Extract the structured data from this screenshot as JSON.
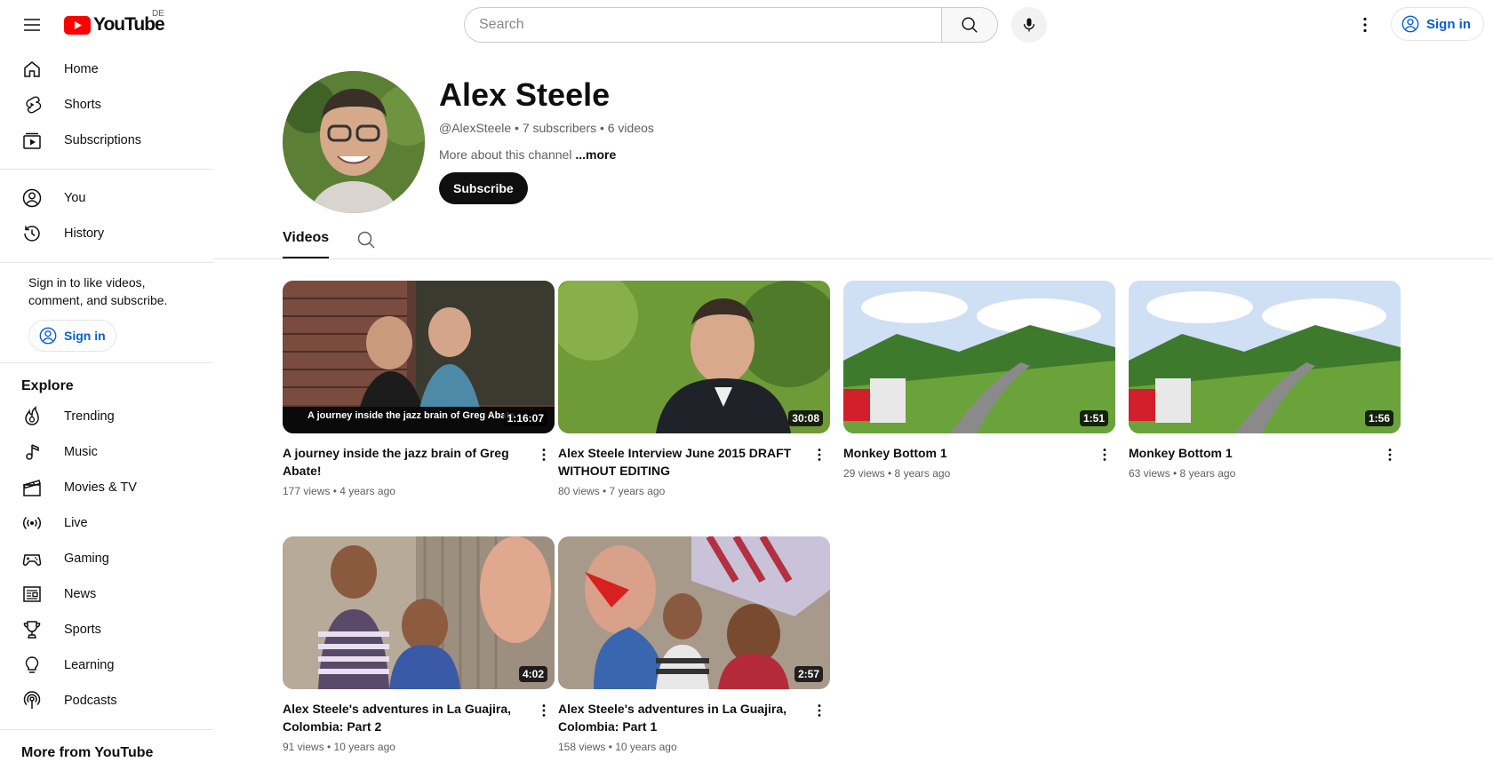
{
  "header": {
    "logo_text": "YouTube",
    "country_code": "DE",
    "search_placeholder": "Search",
    "signin_label": "Sign in"
  },
  "sidebar": {
    "main": [
      {
        "label": "Home",
        "icon": "home-icon"
      },
      {
        "label": "Shorts",
        "icon": "shorts-icon"
      },
      {
        "label": "Subscriptions",
        "icon": "subscriptions-icon"
      }
    ],
    "you": [
      {
        "label": "You",
        "icon": "account-icon"
      },
      {
        "label": "History",
        "icon": "history-icon"
      }
    ],
    "signin_prompt": "Sign in to like videos, comment, and subscribe.",
    "signin_label": "Sign in",
    "explore_title": "Explore",
    "explore": [
      {
        "label": "Trending",
        "icon": "trending-icon"
      },
      {
        "label": "Music",
        "icon": "music-icon"
      },
      {
        "label": "Movies & TV",
        "icon": "movies-icon"
      },
      {
        "label": "Live",
        "icon": "live-icon"
      },
      {
        "label": "Gaming",
        "icon": "gaming-icon"
      },
      {
        "label": "News",
        "icon": "news-icon"
      },
      {
        "label": "Sports",
        "icon": "sports-icon"
      },
      {
        "label": "Learning",
        "icon": "learning-icon"
      },
      {
        "label": "Podcasts",
        "icon": "podcasts-icon"
      }
    ],
    "more_title": "More from YouTube"
  },
  "channel": {
    "name": "Alex Steele",
    "meta": "@AlexSteele • 7 subscribers • 6 videos",
    "about": "More about this channel",
    "more": "...more",
    "subscribe_label": "Subscribe"
  },
  "tabs": {
    "videos": "Videos"
  },
  "videos": [
    {
      "title": "A journey inside the jazz brain of Greg Abate!",
      "meta": "177 views • 4 years ago",
      "duration": "1:16:07",
      "caption": "A journey inside the jazz brain of Greg Abate"
    },
    {
      "title": "Alex Steele Interview June 2015 DRAFT WITHOUT EDITING",
      "meta": "80 views • 7 years ago",
      "duration": "30:08"
    },
    {
      "title": "Monkey Bottom 1",
      "meta": "29 views • 8 years ago",
      "duration": "1:51"
    },
    {
      "title": "Monkey Bottom 1",
      "meta": "63 views • 8 years ago",
      "duration": "1:56"
    },
    {
      "title": "Alex Steele's adventures in La Guajira, Colombia: Part 2",
      "meta": "91 views • 10 years ago",
      "duration": "4:02"
    },
    {
      "title": "Alex Steele's adventures in La Guajira, Colombia: Part 1",
      "meta": "158 views • 10 years ago",
      "duration": "2:57"
    }
  ]
}
